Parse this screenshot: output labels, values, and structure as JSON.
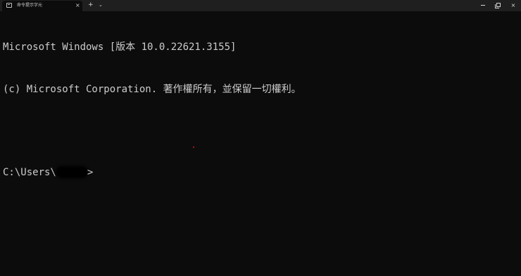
{
  "tab": {
    "title": "命令提示字元",
    "icon": "terminal-icon",
    "close_glyph": "×"
  },
  "tabbar": {
    "new_tab_glyph": "+",
    "dropdown_glyph": "⌄"
  },
  "window_controls": {
    "minimize_icon": "minimize-icon",
    "maximize_icon": "restore-icon",
    "close_glyph": "×"
  },
  "terminal": {
    "lines": [
      "Microsoft Windows [版本 10.0.22621.3155]",
      "(c) Microsoft Corporation. 著作權所有，並保留一切權利。"
    ],
    "prompt_prefix": "C:\\Users\\",
    "prompt_suffix": ">",
    "background": "#0c0c0c",
    "foreground": "#cccccc"
  }
}
